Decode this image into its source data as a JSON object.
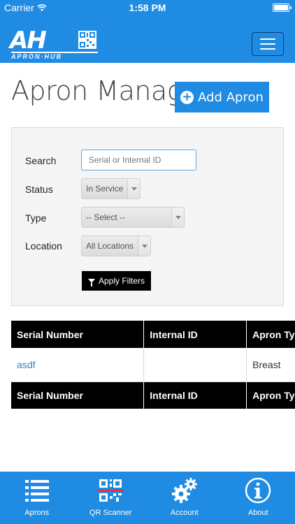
{
  "status_bar": {
    "carrier": "Carrier",
    "time": "1:58 PM"
  },
  "header": {
    "logo_text": "AH",
    "logo_subtext": "APRON·HUB",
    "menu_icon": "hamburger-icon"
  },
  "page": {
    "title": "Apron Manager",
    "add_button_label": "Add Apron"
  },
  "filters": {
    "search_label": "Search",
    "search_placeholder": "Serial or Internal ID",
    "status_label": "Status",
    "status_value": "In Service",
    "type_label": "Type",
    "type_value": "-- Select --",
    "location_label": "Location",
    "location_value": "All Locations",
    "apply_label": "Apply Filters"
  },
  "table": {
    "columns": [
      "Serial Number",
      "Internal ID",
      "Apron Type"
    ],
    "rows": [
      [
        "asdf",
        "",
        "Breast"
      ]
    ],
    "footer_columns": [
      "Serial Number",
      "Internal ID",
      "Apron Type"
    ]
  },
  "tab_bar": {
    "tabs": [
      {
        "label": "Aprons",
        "icon": "list-icon"
      },
      {
        "label": "QR Scanner",
        "icon": "qr-code-icon"
      },
      {
        "label": "Account",
        "icon": "gears-icon"
      },
      {
        "label": "About",
        "icon": "info-icon"
      }
    ]
  },
  "colors": {
    "brand_blue": "#1f8be3",
    "table_header": "#000000",
    "link": "#3a80c0"
  }
}
